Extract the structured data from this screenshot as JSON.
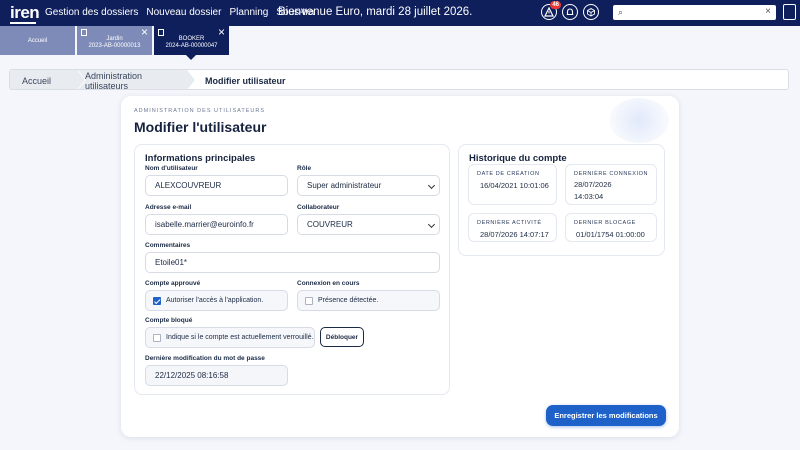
{
  "app": {
    "logo": "iren"
  },
  "nav": {
    "items": [
      "Gestion des dossiers",
      "Nouveau dossier",
      "Planning",
      "Sous-tra"
    ],
    "welcome": "Bienvenue Euro, mardi 28 juillet 2026."
  },
  "header": {
    "notif_badge": "46",
    "search_placeholder": ""
  },
  "tabs": [
    {
      "title": "Accueil"
    },
    {
      "title": "Jardin",
      "subtitle": "2023-AB-00000013"
    },
    {
      "title": "BOOKER",
      "subtitle": "2024-AB-00000047"
    }
  ],
  "breadcrumb": [
    "Accueil",
    "Administration utilisateurs",
    "Modifier utilisateur"
  ],
  "page": {
    "eyebrow": "ADMINISTRATION DES UTILISATEURS",
    "title": "Modifier l'utilisateur"
  },
  "form": {
    "section_title": "Informations principales",
    "username_label": "Nom d'utilisateur",
    "username_value": "ALEXCOUVREUR",
    "role_label": "Rôle",
    "role_value": "Super administrateur",
    "email_label": "Adresse e-mail",
    "email_value": "isabelle.marrier@euroinfo.fr",
    "collab_label": "Collaborateur",
    "collab_value": "COUVREUR",
    "comments_label": "Commentaires",
    "comments_value": "Etoile01*",
    "approved_label": "Compte approuvé",
    "approved_text": "Autoriser l'accès à l'application.",
    "approved_checked": true,
    "connection_label": "Connexion en cours",
    "connection_text": "Présence détectée.",
    "connection_checked": false,
    "locked_label": "Compte bloqué",
    "locked_text": "Indique si le compte est actuellement verrouillé.",
    "locked_checked": false,
    "unlock_label": "Débloquer",
    "pwd_label": "Dernière modification du mot de passe",
    "pwd_value": "22/12/2025 08:16:58"
  },
  "history": {
    "title": "Historique du compte",
    "created_label": "DATE DE CRÉATION",
    "created_value": "16/04/2021 10:01:06",
    "last_conn_label": "DERNIÈRE CONNEXION",
    "last_conn_value": "28/07/2026 14:03:04",
    "last_activity_label": "DERNIÈRE ACTIVITÉ",
    "last_activity_value": "28/07/2026 14:07:17",
    "last_block_label": "DERNIER BLOCAGE",
    "last_block_value": "01/01/1754 01:00:00"
  },
  "actions": {
    "save_label": "Enregistrer les modifications"
  },
  "colors": {
    "navy": "#0f1f5c",
    "tab_inactive": "#7e8bb8",
    "primary": "#1e62c9"
  }
}
